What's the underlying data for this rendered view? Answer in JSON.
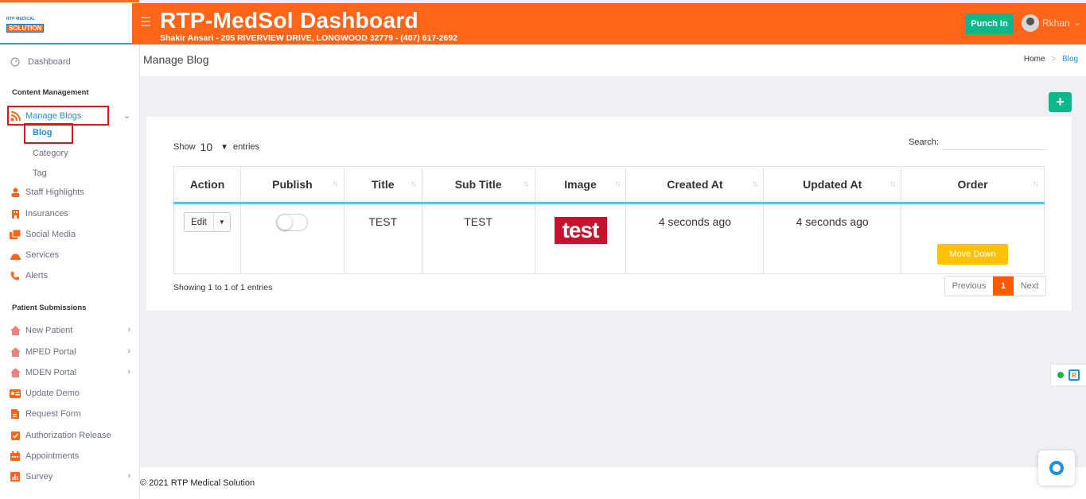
{
  "header": {
    "title": "RTP-MedSol Dashboard",
    "subtitle": "Shakir Ansari - 205 RIVERVIEW DRIVE, LONGWOOD 32779 - (407) 617-2692",
    "punch_label": "Punch In",
    "user_name": "Rkhan"
  },
  "logo": {
    "line1": "RTP MEDICAL",
    "line2": "SOLUTION"
  },
  "sidebar": {
    "dashboard": "Dashboard",
    "content_title": "Content Management",
    "manage_blogs": "Manage Blogs",
    "blog": "Blog",
    "category": "Category",
    "tag": "Tag",
    "staff": "Staff Highlights",
    "insurances": "Insurances",
    "social": "Social Media",
    "services": "Services",
    "alerts": "Alerts",
    "patient_title": "Patient Submissions",
    "new_patient": "New Patient",
    "mped": "MPED Portal",
    "mden": "MDEN Portal",
    "update_demo": "Update Demo",
    "request_form": "Request Form",
    "auth_release": "Authorization Release",
    "appointments": "Appointments",
    "survey": "Survey"
  },
  "page": {
    "title": "Manage Blog",
    "crumb_home": "Home",
    "crumb_current": "Blog"
  },
  "table_controls": {
    "show_label": "Show",
    "show_value": "10",
    "entries_label": "entries",
    "search_label": "Search:",
    "showing_text": "Showing 1 to 1 of 1 entries",
    "prev": "Previous",
    "page": "1",
    "next": "Next"
  },
  "table": {
    "headers": [
      "Action",
      "Publish",
      "Title",
      "Sub Title",
      "Image",
      "Created At",
      "Updated At",
      "Order"
    ],
    "rows": [
      {
        "edit": "Edit",
        "title": "TEST",
        "subtitle": "TEST",
        "image_text": "test",
        "created": "4 seconds ago",
        "updated": "4 seconds ago",
        "order_button": "Move Down"
      }
    ]
  },
  "footer": {
    "copyright": "© 2021 RTP Medical Solution"
  },
  "colors": {
    "primary": "#ff6418",
    "success": "#0cb78a",
    "accent": "#1e8fd8",
    "warning": "#ffc107"
  }
}
